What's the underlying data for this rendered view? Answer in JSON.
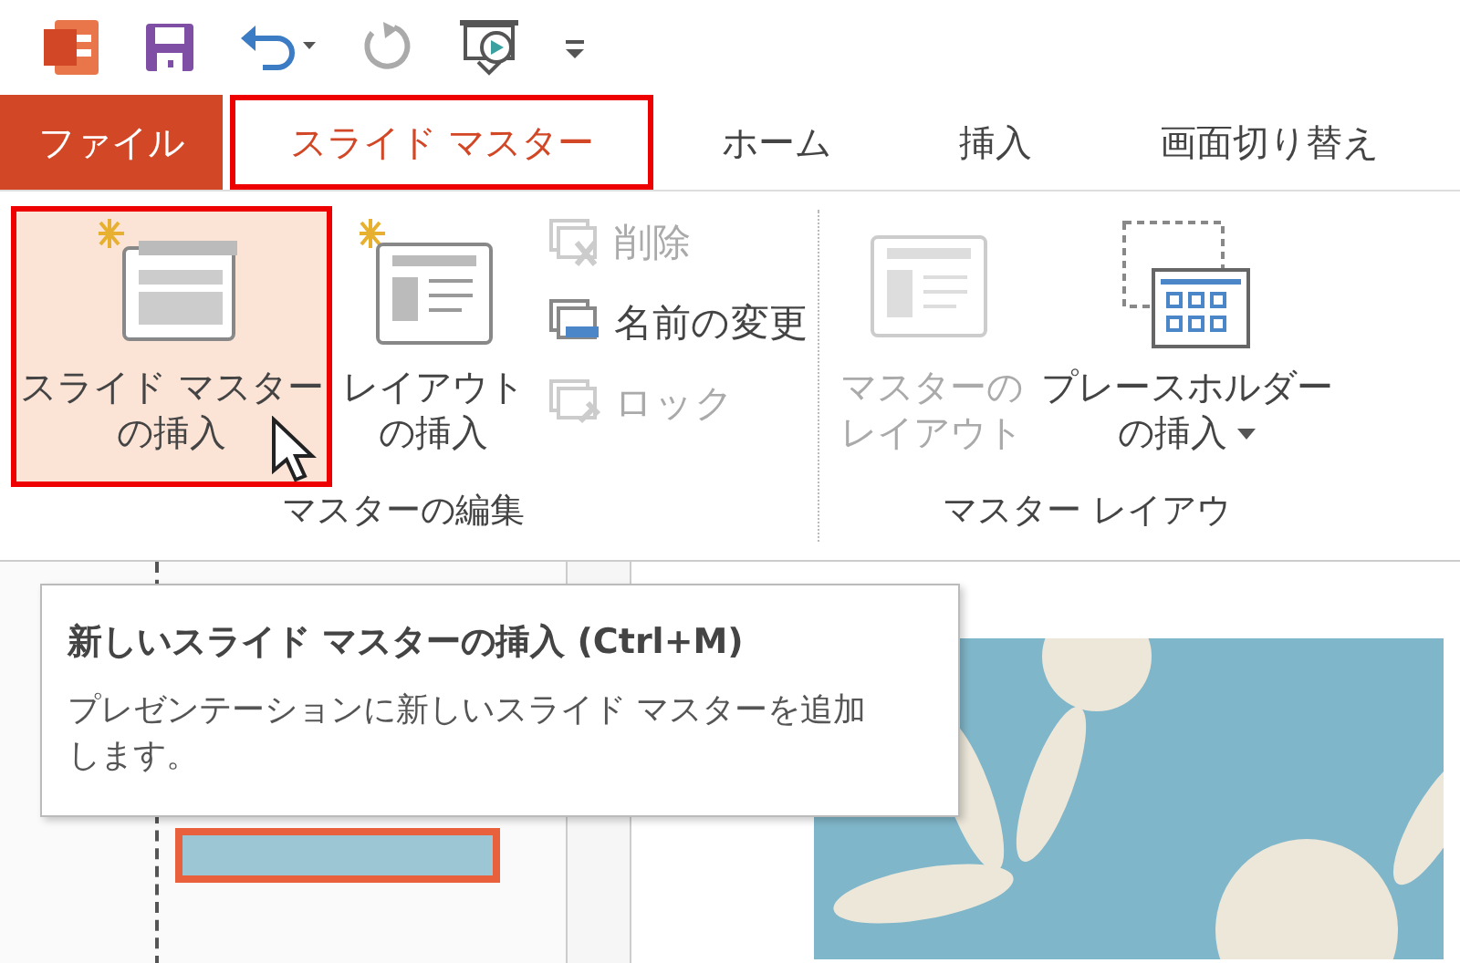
{
  "tabs": [
    {
      "label": "ファイル",
      "kind": "file",
      "selected": false,
      "highlighted": false
    },
    {
      "label": "スライド マスター",
      "kind": "tab",
      "selected": true,
      "highlighted": true
    },
    {
      "label": "ホーム",
      "kind": "tab",
      "selected": false,
      "highlighted": false
    },
    {
      "label": "挿入",
      "kind": "tab",
      "selected": false,
      "highlighted": false
    },
    {
      "label": "画面切り替え",
      "kind": "tab",
      "selected": false,
      "highlighted": false
    }
  ],
  "groups": [
    {
      "label": "マスターの編集",
      "items": [
        {
          "kind": "large",
          "lines": [
            "スライド マスター",
            "の挿入"
          ],
          "disabled": false,
          "highlighted": true,
          "dropdown": false
        },
        {
          "kind": "large",
          "lines": [
            "レイアウト",
            "の挿入"
          ],
          "disabled": false,
          "highlighted": false,
          "dropdown": false
        },
        {
          "kind": "small",
          "lines": [
            "削除"
          ],
          "disabled": true
        },
        {
          "kind": "small",
          "lines": [
            "名前の変更"
          ],
          "disabled": false
        },
        {
          "kind": "small",
          "lines": [
            "ロック"
          ],
          "disabled": true
        }
      ]
    },
    {
      "label": "マスター レイアウ",
      "items": [
        {
          "kind": "large",
          "lines": [
            "マスターの",
            "レイアウト"
          ],
          "disabled": true,
          "highlighted": false,
          "dropdown": false
        },
        {
          "kind": "large",
          "lines": [
            "プレースホルダー",
            "の挿入"
          ],
          "disabled": false,
          "highlighted": false,
          "dropdown": true
        }
      ]
    }
  ],
  "tooltip": {
    "title": "新しいスライド マスターの挿入 (Ctrl+M)",
    "description": "プレゼンテーションに新しいスライド マスターを追加します。"
  }
}
